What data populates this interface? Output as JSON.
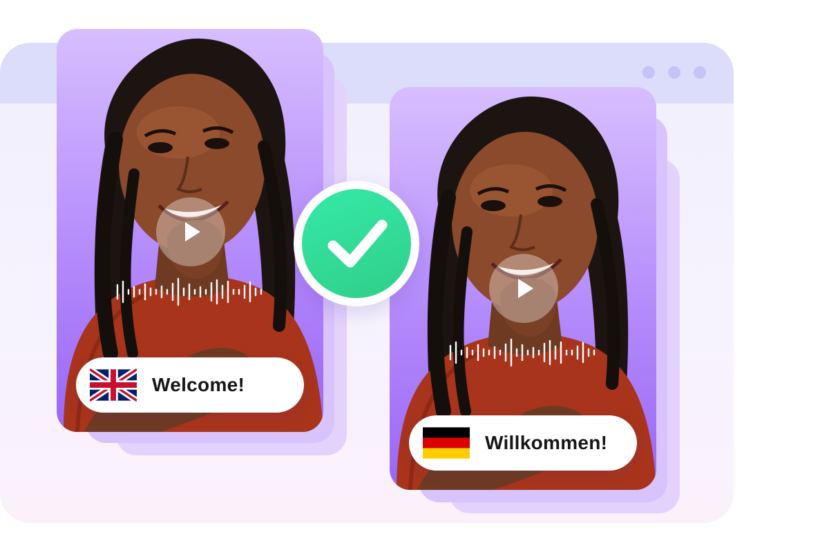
{
  "browser": {
    "window_controls": [
      "dot-icon",
      "dot-icon",
      "dot-icon"
    ],
    "bar_color": "#dcdcfb"
  },
  "cards": [
    {
      "id": "source",
      "language": "English",
      "flag": "uk-flag-icon",
      "phrase": "Welcome!"
    },
    {
      "id": "translated",
      "language": "German",
      "flag": "germany-flag-icon",
      "phrase": "Willkommen!"
    }
  ],
  "status": {
    "icon": "checkmark-icon",
    "color": "#2fd98f"
  },
  "colors": {
    "card_top": "#d7befe",
    "card_bottom": "#9a66f5",
    "accent": "#2fcf8a"
  }
}
